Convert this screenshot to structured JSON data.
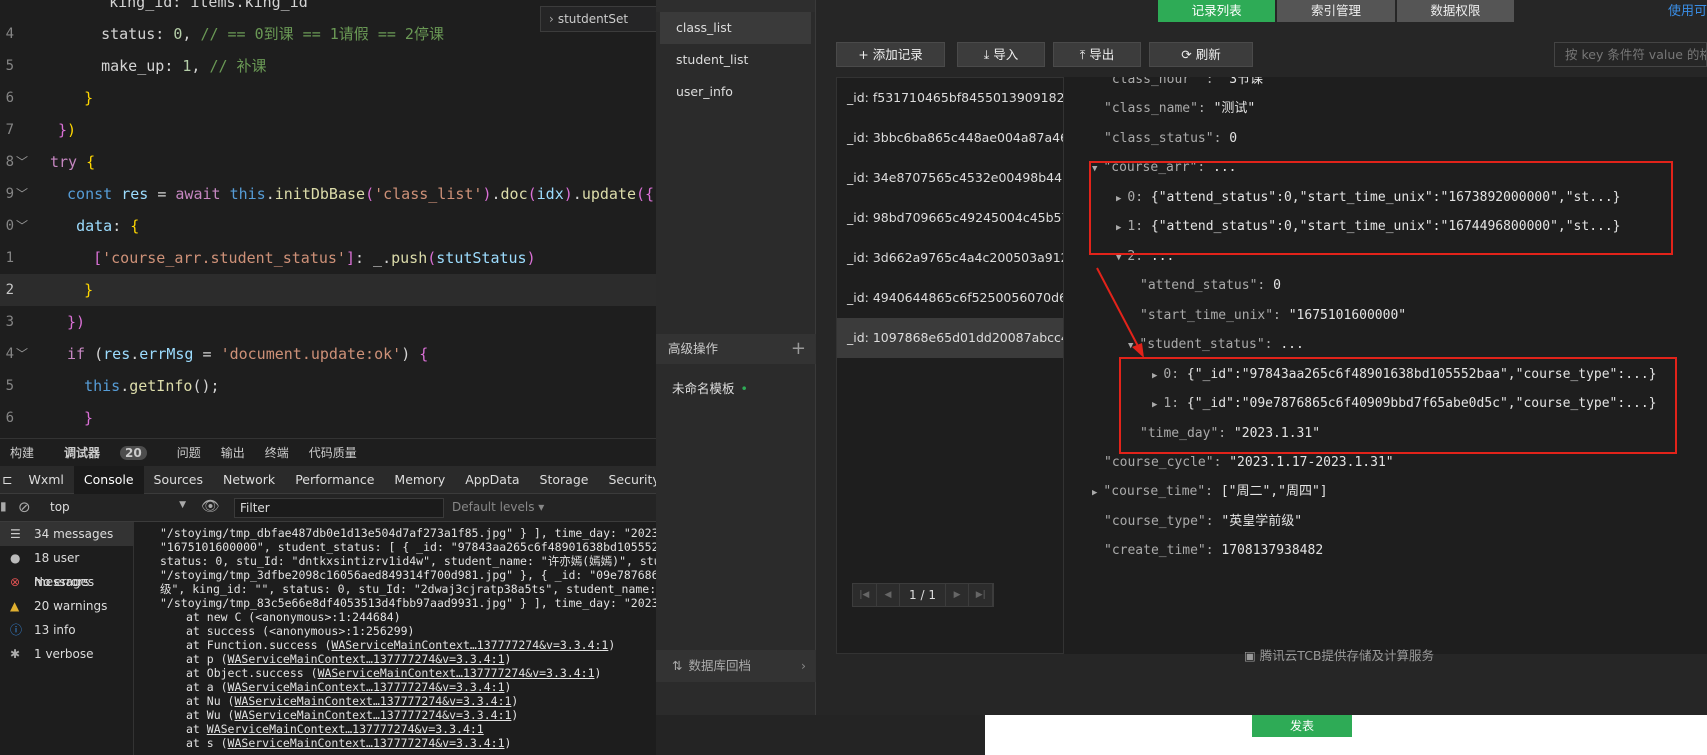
{
  "editor": {
    "breadcrumb": "stutdentSet",
    "lines": [
      {
        "ln": "",
        "segs": [
          [
            "   king_id: items.king_id",
            "p"
          ]
        ]
      },
      {
        "ln": "4",
        "segs": [
          [
            "   ",
            "p"
          ],
          [
            "status",
            "p"
          ],
          [
            ": ",
            "p"
          ],
          [
            "0",
            "n"
          ],
          [
            ", ",
            "p"
          ],
          [
            "// == 0到课 == 1请假 == 2停课",
            "c"
          ]
        ]
      },
      {
        "ln": "5",
        "segs": [
          [
            "   make_up",
            "p"
          ],
          [
            ": ",
            "p"
          ],
          [
            "1",
            "n"
          ],
          [
            ", ",
            "p"
          ],
          [
            "// 补课",
            "c"
          ]
        ]
      },
      {
        "ln": "6",
        "segs": [
          [
            "  ",
            "p"
          ],
          [
            "}",
            "y"
          ]
        ]
      },
      {
        "ln": "7",
        "segs": [
          [
            "}",
            "pp"
          ],
          [
            ")",
            "y"
          ]
        ]
      },
      {
        "ln": "8",
        "segs": [
          [
            "try",
            "pk"
          ],
          [
            " ",
            "p"
          ],
          [
            "{",
            "y"
          ]
        ]
      },
      {
        "ln": "9",
        "segs": [
          [
            " ",
            "p"
          ],
          [
            "const",
            "k"
          ],
          [
            " ",
            "p"
          ],
          [
            "res",
            "v"
          ],
          [
            " = ",
            "p"
          ],
          [
            "await",
            "pk"
          ],
          [
            " ",
            "p"
          ],
          [
            "this",
            "k"
          ],
          [
            ".",
            "p"
          ],
          [
            "initDbBase",
            "f"
          ],
          [
            "(",
            "pp"
          ],
          [
            "'class_list'",
            "s"
          ],
          [
            ")",
            "pp"
          ],
          [
            ".",
            "p"
          ],
          [
            "doc",
            "f"
          ],
          [
            "(",
            "pp"
          ],
          [
            "idx",
            "v"
          ],
          [
            ")",
            "pp"
          ],
          [
            ".",
            "p"
          ],
          [
            "update",
            "f"
          ],
          [
            "({",
            "pp"
          ]
        ]
      },
      {
        "ln": "0",
        "segs": [
          [
            "  ",
            "p"
          ],
          [
            "data",
            "v"
          ],
          [
            ": ",
            "p"
          ],
          [
            "{",
            "y"
          ]
        ]
      },
      {
        "ln": "1",
        "segs": [
          [
            "   ",
            "p"
          ],
          [
            "[",
            "pp"
          ],
          [
            "'course_arr.student_status'",
            "s"
          ],
          [
            "]",
            "pp"
          ],
          [
            ": _.",
            "p"
          ],
          [
            "push",
            "f"
          ],
          [
            "(",
            "pp"
          ],
          [
            "stutStatus",
            "v"
          ],
          [
            ")",
            "pp"
          ]
        ]
      },
      {
        "ln": "2",
        "segs": [
          [
            "  ",
            "p"
          ],
          [
            "}",
            "y"
          ]
        ]
      },
      {
        "ln": "3",
        "segs": [
          [
            " })",
            "pp"
          ]
        ]
      },
      {
        "ln": "4",
        "segs": [
          [
            " ",
            "p"
          ],
          [
            "if",
            "pk"
          ],
          [
            " (",
            "p"
          ],
          [
            "res",
            "v"
          ],
          [
            ".",
            "p"
          ],
          [
            "errMsg",
            "v"
          ],
          [
            " = ",
            "p"
          ],
          [
            "'document.update:ok'",
            "s"
          ],
          [
            ") ",
            "p"
          ],
          [
            "{",
            "pp"
          ]
        ]
      },
      {
        "ln": "5",
        "segs": [
          [
            "  ",
            "p"
          ],
          [
            "this",
            "k"
          ],
          [
            ".",
            "p"
          ],
          [
            "getInfo",
            "f"
          ],
          [
            "();",
            "p"
          ]
        ]
      },
      {
        "ln": "6",
        "segs": [
          [
            "  }",
            "pp"
          ]
        ]
      }
    ]
  },
  "panel_tabs": {
    "t0": "构建",
    "t1": "调试器",
    "count": "20",
    "t2": "问题",
    "t3": "输出",
    "t4": "终端",
    "t5": "代码质量"
  },
  "devtools_tabs": [
    "Wxml",
    "Console",
    "Sources",
    "Network",
    "Performance",
    "Memory",
    "AppData",
    "Storage",
    "Security"
  ],
  "console_toolbar": {
    "context": "top",
    "filter_placeholder": "Filter",
    "levels": "Default levels ▾"
  },
  "console_sidebar": [
    {
      "icon": "☰",
      "label": "34 messages",
      "color": "#cccccc"
    },
    {
      "icon": "●",
      "label": "18 user messages",
      "color": "#bbbbbb"
    },
    {
      "icon": "⊗",
      "label": "No errors",
      "color": "#e05252"
    },
    {
      "icon": "▲",
      "label": "20 warnings",
      "color": "#e0b030"
    },
    {
      "icon": "ⓘ",
      "label": "13 info",
      "color": "#3a8ee6"
    },
    {
      "icon": "✱",
      "label": "1 verbose",
      "color": "#aaaaaa"
    }
  ],
  "console_log": [
    "\"/stoyimg/tmp_dbfae487db0e1d13e504d7af273a1f85.jpg\" } ], time_day: \"2023.1.3",
    "\"1675101600000\", student_status: [ { _id: \"97843aa265c6f48901638bd105552baa\"",
    "status: 0, stu_Id: \"dntkxsintizrv1id4w\", student_name: \"许亦嫣(嫣嫣)\", studen",
    "\"/stoyimg/tmp_3dfbe2098c16056aed849314f700d981.jpg\" }, { _id: \"09e7876865c6",
    "级\", king_id: \"\", status: 0, stu_Id: \"2dwaj3cjratp38a5ts\", student_name: \"奕",
    "\"/stoyimg/tmp_83c5e66e8df4053513d4fbb97aad9931.jpg\" } ], time_day: \"2023.1.",
    "at new C (<anonymous>:1:244684)",
    "at success (<anonymous>:1:256299)",
    "at Function.success (WAServiceMainContext…137777274&v=3.3.4:1)",
    "at p (WAServiceMainContext…137777274&v=3.3.4:1)",
    "at Object.success (WAServiceMainContext…137777274&v=3.3.4:1)",
    "at a (WAServiceMainContext…137777274&v=3.3.4:1)",
    "at Nu (WAServiceMainContext…137777274&v=3.3.4:1)",
    "at Wu (WAServiceMainContext…137777274&v=3.3.4:1)",
    "at WAServiceMainContext…137777274&v=3.3.4:1",
    "at s (WAServiceMainContext…137777274&v=3.3.4:1)"
  ],
  "db": {
    "collections": [
      "class_list",
      "student_list",
      "user_info"
    ],
    "advanced_label": "高级操作",
    "template_label": "未命名模板",
    "rollback_label": "数据库回档",
    "top_tabs": [
      "记录列表",
      "索引管理",
      "数据权限"
    ],
    "help_link": "使用可",
    "toolbar": {
      "add": "添加记录",
      "import": "导入",
      "export": "导出",
      "refresh": "刷新",
      "search_placeholder": "按 key 条件符 value 的格"
    },
    "records": [
      "_id: f531710465bf84550139091828...",
      "_id: 3bbc6ba865c448ae004a87a46...",
      "_id: 34e8707565c4532e00498b443...",
      "_id: 98bd709665c49245004c45b57...",
      "_id: 3d662a9765c4a4c200503a912...",
      "_id: 4940644865c6f5250056070d6...",
      "_id: 1097868e65d01dd20087abcc4..."
    ],
    "pager": "1 / 1",
    "footer": "腾讯云TCB提供存储及计算服务",
    "bottom_button": "发表",
    "detail": [
      {
        "k": "\"class_hour\" : ",
        "v": "\"3节课\"",
        "tri": ""
      },
      {
        "k": "\"class_name\": ",
        "v": "\"测试\"",
        "tri": ""
      },
      {
        "k": "\"class_status\": ",
        "v": "0",
        "tri": ""
      },
      {
        "k": "\"course_arr\": ",
        "v": "...",
        "tri": "▼"
      },
      {
        "k": "0: ",
        "v": "{\"attend_status\":0,\"start_time_unix\":\"1673892000000\",\"st...}",
        "tri": "▶"
      },
      {
        "k": "1: ",
        "v": "{\"attend_status\":0,\"start_time_unix\":\"1674496800000\",\"st...}",
        "tri": "▶"
      },
      {
        "k": "2: ",
        "v": "...",
        "tri": "▼"
      },
      {
        "k": "\"attend_status\": ",
        "v": "0",
        "tri": ""
      },
      {
        "k": "\"start_time_unix\": ",
        "v": "\"1675101600000\"",
        "tri": ""
      },
      {
        "k": "\"student_status\": ",
        "v": "...",
        "tri": "▼"
      },
      {
        "k": "0: ",
        "v": "{\"_id\":\"97843aa265c6f48901638bd105552baa\",\"course_type\":...}",
        "tri": "▶"
      },
      {
        "k": "1: ",
        "v": "{\"_id\":\"09e7876865c6f40909bbd7f65abe0d5c\",\"course_type\":...}",
        "tri": "▶"
      },
      {
        "k": "\"time_day\": ",
        "v": "\"2023.1.31\"",
        "tri": ""
      },
      {
        "k": "\"course_cycle\": ",
        "v": "\"2023.1.17-2023.1.31\"",
        "tri": ""
      },
      {
        "k": "\"course_time\": ",
        "v": "[\"周二\",\"周四\"]",
        "tri": "▶"
      },
      {
        "k": "\"course_type\": ",
        "v": "\"英皇学前级\"",
        "tri": ""
      },
      {
        "k": "\"create_time\": ",
        "v": "1708137938482",
        "tri": ""
      }
    ]
  }
}
